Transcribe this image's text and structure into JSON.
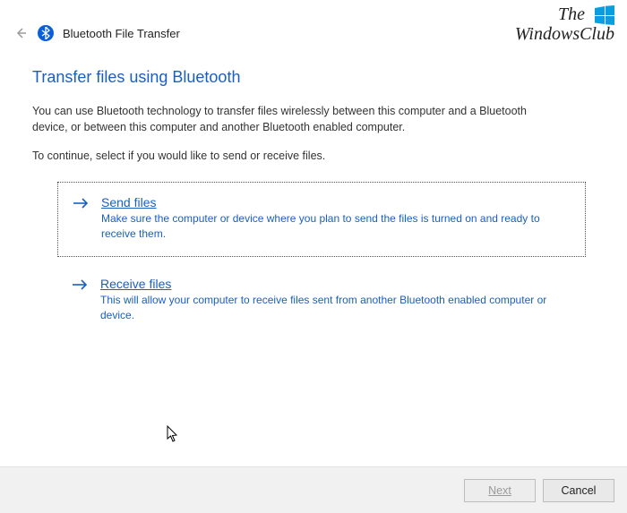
{
  "watermark": {
    "line1": "The",
    "line2": "WindowsClub"
  },
  "titlebar": {
    "title": "Bluetooth File Transfer"
  },
  "page": {
    "heading": "Transfer files using Bluetooth",
    "description": "You can use Bluetooth technology to transfer files wirelessly between this computer and a Bluetooth device, or between this computer and another Bluetooth enabled computer.",
    "instruction": "To continue, select if you would like to send or receive files."
  },
  "options": {
    "send": {
      "title": "Send files",
      "subtitle": "Make sure the computer or device where you plan to send the files is turned on and ready to receive them."
    },
    "receive": {
      "title": "Receive files",
      "subtitle": "This will allow your computer to receive files sent from another Bluetooth enabled computer or device."
    }
  },
  "footer": {
    "next": "Next",
    "cancel": "Cancel"
  }
}
